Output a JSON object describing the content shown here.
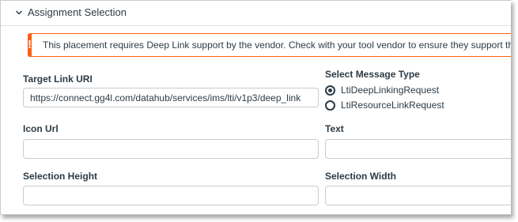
{
  "section": {
    "title": "Assignment Selection",
    "toggle_icon": "chevron-down-icon"
  },
  "alert": {
    "icon": "exclamation-icon",
    "icon_glyph": "!",
    "message": "This placement requires Deep Link support by the vendor. Check with your tool vendor to ensure they support this functionality",
    "accent_color": "#fc5e13"
  },
  "fields": {
    "target_link_uri": {
      "label": "Target Link URI",
      "value": "https://connect.gg4l.com/datahub/services/ims/lti/v1p3/deep_link"
    },
    "icon_url": {
      "label": "Icon Url",
      "value": ""
    },
    "text": {
      "label": "Text",
      "value": ""
    },
    "selection_height": {
      "label": "Selection Height",
      "value": ""
    },
    "selection_width": {
      "label": "Selection Width",
      "value": ""
    }
  },
  "message_type": {
    "label": "Select Message Type",
    "options": [
      {
        "label": "LtiDeepLinkingRequest",
        "selected": true
      },
      {
        "label": "LtiResourceLinkRequest",
        "selected": false
      }
    ]
  }
}
